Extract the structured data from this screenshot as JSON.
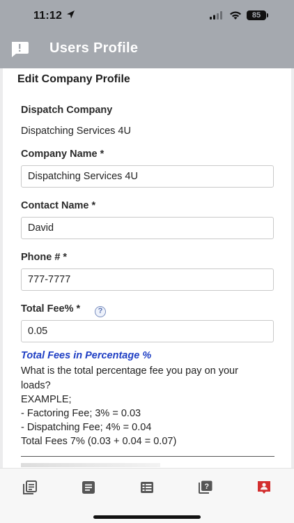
{
  "status_bar": {
    "time": "11:12",
    "battery": "85",
    "icons": [
      "location-arrow-icon",
      "cellular-signal-icon",
      "wifi-icon",
      "battery-icon"
    ]
  },
  "header": {
    "title": "Users Profile",
    "left_icon": "chat-alert-icon"
  },
  "form": {
    "title": "Edit Company Profile",
    "dispatch_company": {
      "label": "Dispatch Company",
      "value": "Dispatching Services 4U"
    },
    "company_name": {
      "label": "Company Name  *",
      "value": "Dispatching Services 4U"
    },
    "contact_name": {
      "label": "Contact Name  *",
      "value": "David"
    },
    "phone": {
      "label": "Phone #  *",
      "value": "777-7777"
    },
    "total_fee": {
      "label": "Total Fee%  *",
      "help_icon": "?",
      "value": "0.05"
    }
  },
  "fees_help": {
    "title": "Total Fees in Percentage %",
    "lines": [
      "What is the total percentage fee you pay on your",
      "loads?",
      "EXAMPLE;",
      "- Factoring Fee; 3% = 0.03",
      "- Dispatching Fee; 4% = 0.04",
      "Total Fees 7% (0.03 + 0.04 = 0.07)"
    ]
  },
  "tab_bar": {
    "tabs": [
      {
        "icon": "documents-icon",
        "active": false
      },
      {
        "icon": "list-document-icon",
        "active": false
      },
      {
        "icon": "table-list-icon",
        "active": false
      },
      {
        "icon": "help-message-icon",
        "active": false
      },
      {
        "icon": "user-profile-icon",
        "active": true
      }
    ],
    "active_color": "#d32f2f",
    "inactive_color": "#555555"
  },
  "colors": {
    "header_bg": "#a5a9af",
    "link_blue": "#1f3fc4",
    "help_icon": "#5b73b2"
  }
}
